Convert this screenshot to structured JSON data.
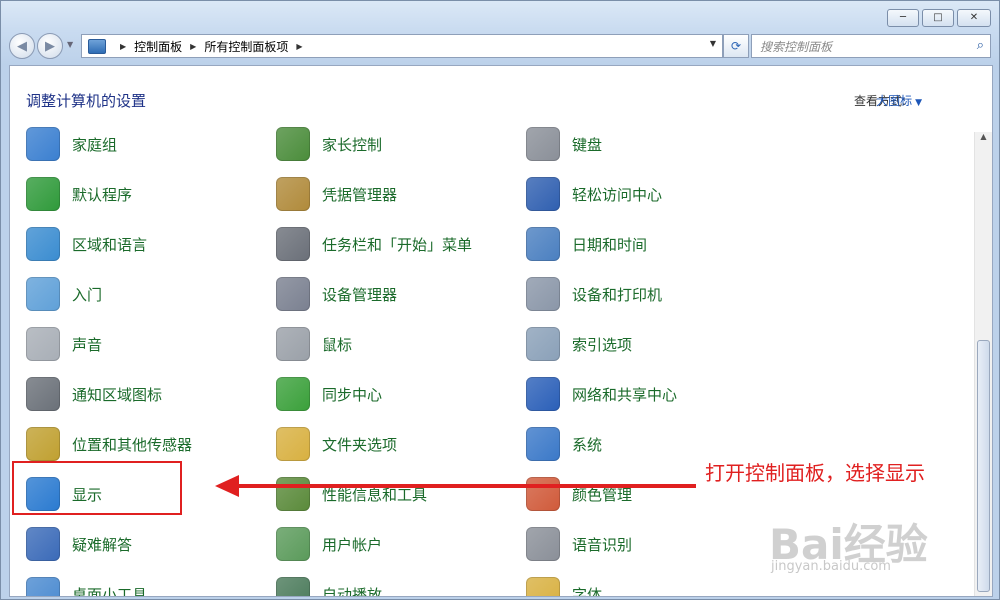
{
  "window": {
    "minimize_glyph": "─",
    "maximize_glyph": "□",
    "close_glyph": "✕"
  },
  "nav": {
    "back_glyph": "◀",
    "forward_glyph": "▶",
    "breadcrumb": [
      "控制面板",
      "所有控制面板项"
    ],
    "search_placeholder": "搜索控制面板"
  },
  "header": {
    "title": "调整计算机的设置",
    "view_by_label": "查看方式:",
    "view_by_value": "大图标"
  },
  "items": [
    {
      "label": "家庭组",
      "icon": "homegroup-icon",
      "color": "#3a7fd0"
    },
    {
      "label": "家长控制",
      "icon": "parental-controls-icon",
      "color": "#4a8c3a"
    },
    {
      "label": "键盘",
      "icon": "keyboard-icon",
      "color": "#8a8f98"
    },
    {
      "label": "默认程序",
      "icon": "default-programs-icon",
      "color": "#2f9a3a"
    },
    {
      "label": "凭据管理器",
      "icon": "credential-manager-icon",
      "color": "#b08a3a"
    },
    {
      "label": "轻松访问中心",
      "icon": "ease-of-access-icon",
      "color": "#2f5fb0"
    },
    {
      "label": "区域和语言",
      "icon": "region-language-icon",
      "color": "#3a8cd0"
    },
    {
      "label": "任务栏和「开始」菜单",
      "icon": "taskbar-icon",
      "color": "#6a6f78"
    },
    {
      "label": "日期和时间",
      "icon": "date-time-icon",
      "color": "#4a7fc0"
    },
    {
      "label": "入门",
      "icon": "getting-started-icon",
      "color": "#5fa0d8"
    },
    {
      "label": "设备管理器",
      "icon": "device-manager-icon",
      "color": "#7a8090"
    },
    {
      "label": "设备和打印机",
      "icon": "devices-printers-icon",
      "color": "#8a96a8"
    },
    {
      "label": "声音",
      "icon": "sound-icon",
      "color": "#a8aeb6"
    },
    {
      "label": "鼠标",
      "icon": "mouse-icon",
      "color": "#9aa0a8"
    },
    {
      "label": "索引选项",
      "icon": "indexing-options-icon",
      "color": "#8aa0b8"
    },
    {
      "label": "通知区域图标",
      "icon": "notification-area-icon",
      "color": "#6a7078"
    },
    {
      "label": "同步中心",
      "icon": "sync-center-icon",
      "color": "#3aa03a"
    },
    {
      "label": "网络和共享中心",
      "icon": "network-sharing-icon",
      "color": "#2a5fb8"
    },
    {
      "label": "位置和其他传感器",
      "icon": "location-sensors-icon",
      "color": "#c0a030"
    },
    {
      "label": "文件夹选项",
      "icon": "folder-options-icon",
      "color": "#d8b040"
    },
    {
      "label": "系统",
      "icon": "system-icon",
      "color": "#3a78c8"
    },
    {
      "label": "显示",
      "icon": "display-icon",
      "color": "#2a7ad0"
    },
    {
      "label": "性能信息和工具",
      "icon": "performance-icon",
      "color": "#5a8a3a"
    },
    {
      "label": "颜色管理",
      "icon": "color-management-icon",
      "color": "#d05a3a"
    },
    {
      "label": "疑难解答",
      "icon": "troubleshooting-icon",
      "color": "#3a6ab8"
    },
    {
      "label": "用户帐户",
      "icon": "user-accounts-icon",
      "color": "#5a9a5a"
    },
    {
      "label": "语音识别",
      "icon": "speech-recognition-icon",
      "color": "#8a8f98"
    },
    {
      "label": "桌面小工具",
      "icon": "desktop-gadgets-icon",
      "color": "#4a8ad0"
    },
    {
      "label": "自动播放",
      "icon": "autoplay-icon",
      "color": "#4a7a5a"
    },
    {
      "label": "字体",
      "icon": "fonts-icon",
      "color": "#d8b040"
    }
  ],
  "annotation": {
    "text": "打开控制面板，选择显示"
  },
  "watermark": {
    "brand": "Bai经验",
    "sub": "jingyan.baidu.com"
  }
}
